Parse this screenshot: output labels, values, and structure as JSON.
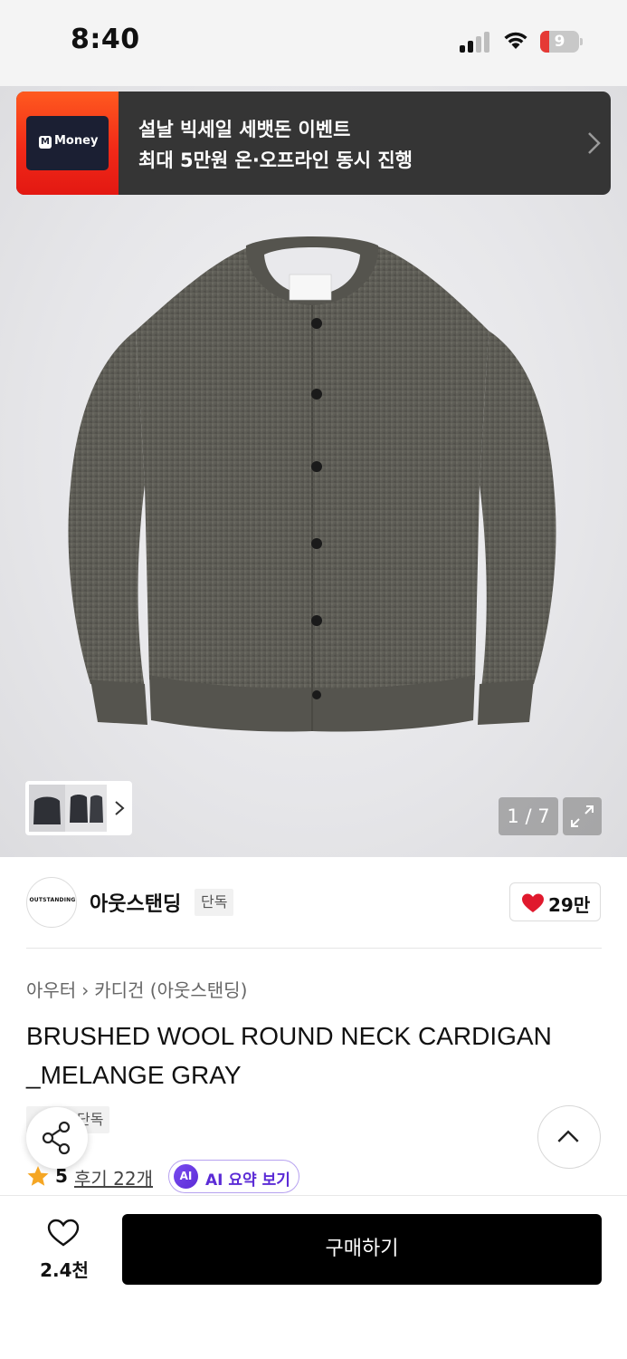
{
  "status_bar": {
    "time": "8:40",
    "battery_level": "9",
    "icons": [
      "cellular-signal-icon",
      "wifi-icon",
      "battery-icon"
    ]
  },
  "banner": {
    "card_logo": "M",
    "card_text": "Money",
    "line1": "설날 빅세일 세뱃돈 이벤트",
    "line2": "최대 5만원 온·오프라인 동시 진행",
    "colors": {
      "accent": "#f12a18",
      "background": "#353535"
    }
  },
  "gallery": {
    "page_counter": "1 / 7",
    "icons": [
      "chevron-right-icon",
      "expand-icon"
    ]
  },
  "brand": {
    "logo_text": "OUTSTANDING",
    "name": "아웃스탠딩",
    "badge": "단독",
    "likes": "29만"
  },
  "breadcrumb": {
    "category": "아우터",
    "subcategory": "카디건 (아웃스탠딩)"
  },
  "product": {
    "title": "BRUSHED WOOL ROUND NECK CARDIGAN _MELANGE GRAY",
    "tag": "단독"
  },
  "rating": {
    "score": "5",
    "reviews_label": "후기 22개",
    "ai_badge": "AI",
    "ai_label": "AI 요약 보기"
  },
  "bottom_bar": {
    "wish_count": "2.4천",
    "buy_label": "구매하기",
    "colors": {
      "buy_button": "#000000",
      "heart": "#e0192d"
    }
  }
}
